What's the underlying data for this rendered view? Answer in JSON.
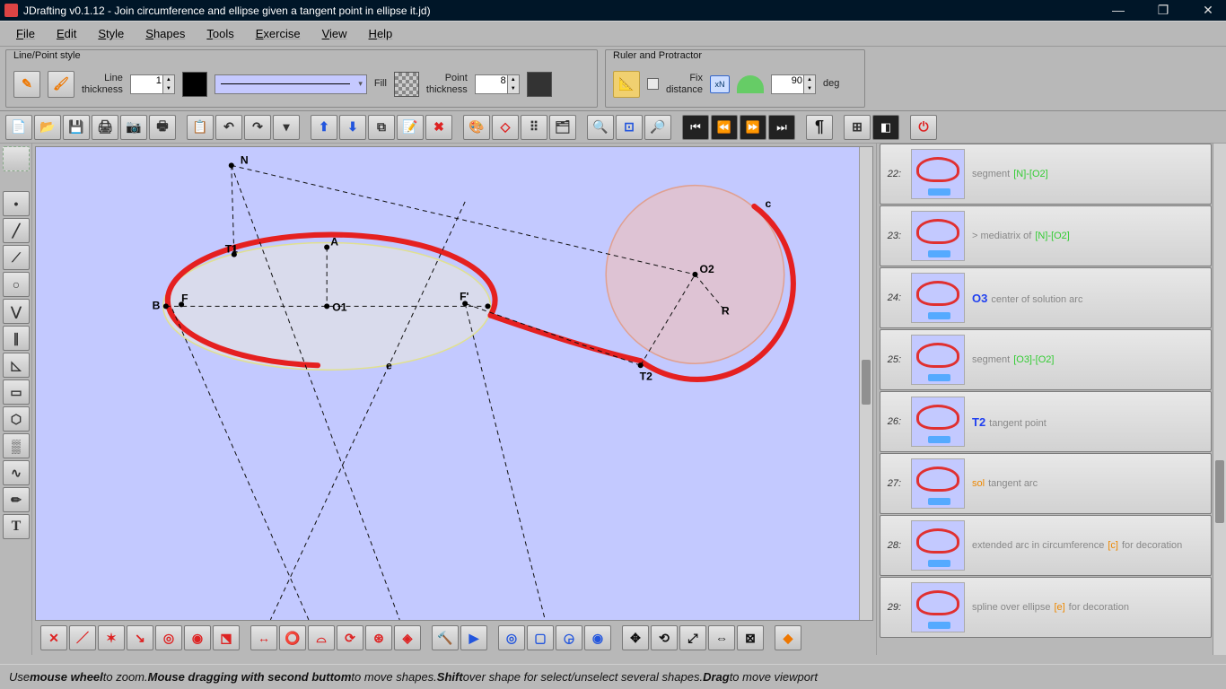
{
  "titlebar": {
    "text": "JDrafting   v0.1.12 - Join circumference and ellipse  given a tangent point in ellipse                                                                                                          it.jd)"
  },
  "menu": {
    "items": [
      "File",
      "Edit",
      "Style",
      "Shapes",
      "Tools",
      "Exercise",
      "View",
      "Help"
    ]
  },
  "panels": {
    "linePoint": {
      "title": "Line/Point style",
      "lineThickLabel": "Line\nthickness",
      "lineThick": "1",
      "fillLabel": "Fill",
      "pointThickLabel": "Point\nthickness",
      "pointThick": "8"
    },
    "ruler": {
      "title": "Ruler and Protractor",
      "fixLabel": "Fix\ndistance",
      "xn": "xN",
      "angle": "90",
      "degLabel": "deg"
    }
  },
  "steps": [
    {
      "num": "22:",
      "bold": "",
      "desc": "segment",
      "green": "[N]-[O2]"
    },
    {
      "num": "23:",
      "bold": "",
      "desc": "> mediatrix of",
      "green": "[N]-[O2]"
    },
    {
      "num": "24:",
      "bold": "O3",
      "desc": "center of solution arc",
      "green": ""
    },
    {
      "num": "25:",
      "bold": "",
      "desc": "segment",
      "green": "[O3]-[O2]"
    },
    {
      "num": "26:",
      "bold": "T2",
      "desc": "tangent point",
      "green": ""
    },
    {
      "num": "27:",
      "bold": "",
      "desc": "tangent arc",
      "green": "",
      "orange": "sol"
    },
    {
      "num": "28:",
      "bold": "",
      "desc": "extended arc in circumference ",
      "orange": "[c]",
      "desc2": " for decoration"
    },
    {
      "num": "29:",
      "bold": "",
      "desc": "spline over ellipse ",
      "orange": "[e]",
      "desc2": " for decoration"
    }
  ],
  "canvas": {
    "labels": {
      "N": "N",
      "T1": "T1",
      "A": "A",
      "B": "B",
      "F": "F",
      "Fp": "F'",
      "O1": "O1",
      "O2": "O2",
      "c": "c",
      "R": "R",
      "T2": "T2",
      "e": "e"
    }
  },
  "status": {
    "p1": "Use ",
    "b1": "mouse wheel",
    "p2": " to zoom. ",
    "b2": "Mouse dragging with second buttom",
    "p3": " to move shapes. ",
    "b3": "Shift",
    "p4": " over shape for select/unselect several shapes. ",
    "b4": "Drag",
    "p5": " to move viewport"
  },
  "colors": {
    "accent": "#e52020",
    "canvas": "#c3c9ff",
    "circle": "#e8b0a0"
  }
}
